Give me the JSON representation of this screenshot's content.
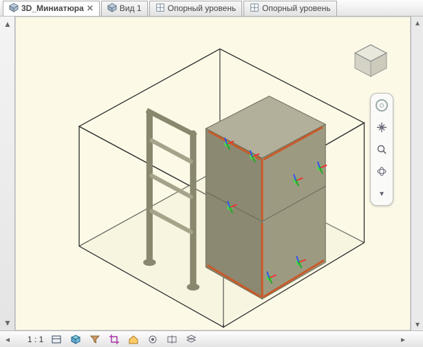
{
  "tabs": [
    {
      "label": "3D_Миниатюра",
      "icon": "cube",
      "active": true,
      "closable": true
    },
    {
      "label": "Вид 1",
      "icon": "cube",
      "active": false,
      "closable": false
    },
    {
      "label": "Опорный уровень",
      "icon": "plan",
      "active": false,
      "closable": false
    },
    {
      "label": "Опорный уровень",
      "icon": "plan",
      "active": false,
      "closable": false
    }
  ],
  "statusbar": {
    "scale_label": "1 : 1",
    "tools": [
      "display-model-icon",
      "box-icon",
      "filter-icon",
      "crop-icon",
      "home-icon",
      "reveal-icon",
      "section-icon",
      "layers-icon"
    ]
  },
  "nav_panel": {
    "tools": [
      "steering-wheel-icon",
      "pan-icon",
      "zoom-extents-icon",
      "orbit-icon",
      "chevron-down-icon"
    ]
  },
  "viewcube": {
    "visible": true
  },
  "colors": {
    "bg": "#fcfae7",
    "box_edge": "#2f2f2f",
    "box_fill": "rgba(252,250,231,0.0)",
    "solid_light": "#b2b09a",
    "solid_mid": "#9d9a82",
    "solid_dark": "#8b8971",
    "accent": "#c85a2a",
    "frame": "#a6a38b",
    "floor": "#d5d2b8"
  }
}
